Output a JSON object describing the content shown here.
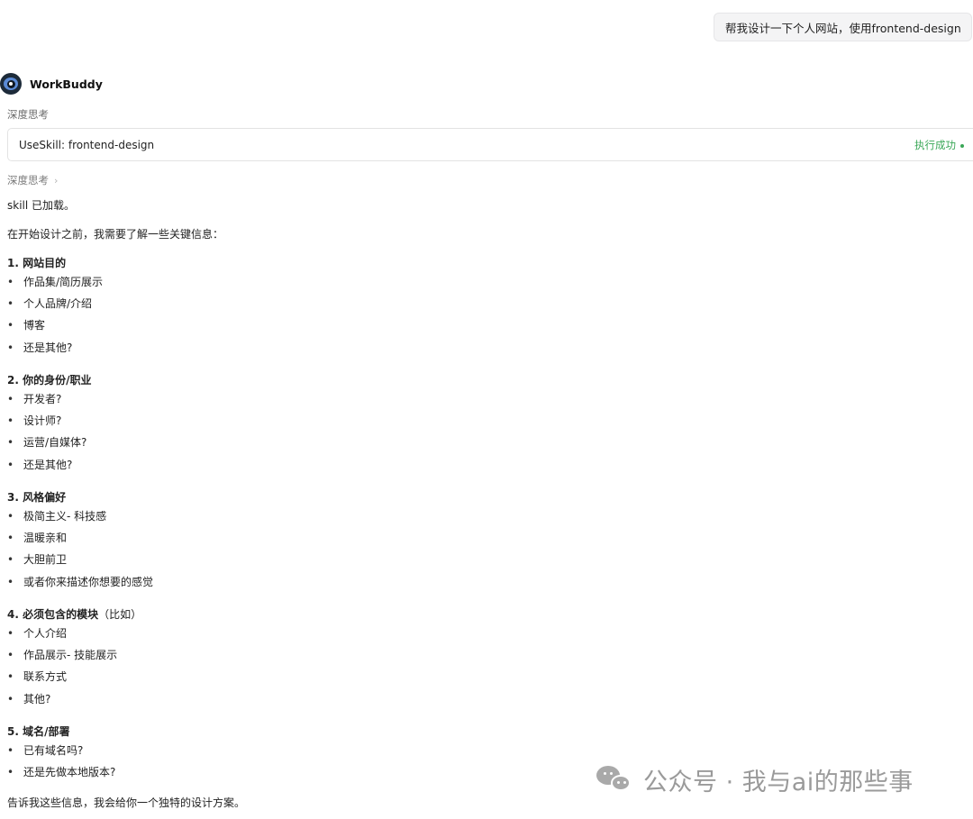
{
  "user_message": "帮我设计一下个人网站，使用frontend-design",
  "agent": {
    "name": "WorkBuddy"
  },
  "thinking_label": "深度思考",
  "skill_call": {
    "name": "UseSkill: frontend-design",
    "status": "执行成功",
    "status_color": "#3aa757"
  },
  "thinking_toggle": "深度思考",
  "response": {
    "loaded": "skill 已加载。",
    "intro": "在开始设计之前，我需要了解一些关键信息：",
    "sections": [
      {
        "title": "1. 网站目的",
        "items": [
          "作品集/简历展示",
          "个人品牌/介绍",
          "博客",
          "还是其他?"
        ]
      },
      {
        "title": "2. 你的身份/职业",
        "items": [
          "开发者?",
          "设计师?",
          "运营/自媒体?",
          "还是其他?"
        ]
      },
      {
        "title": "3. 风格偏好",
        "items": [
          "极简主义- 科技感",
          "温暖亲和",
          "大胆前卫",
          "或者你来描述你想要的感觉"
        ]
      },
      {
        "title": "4. 必须包含的模块",
        "note": "（比如）",
        "items": [
          "个人介绍",
          "作品展示- 技能展示",
          "联系方式",
          "其他?"
        ]
      },
      {
        "title": "5. 域名/部署",
        "items": [
          "已有域名吗?",
          "还是先做本地版本?"
        ]
      }
    ],
    "closing": "告诉我这些信息，我会给你一个独特的设计方案。"
  },
  "watermark": {
    "icon": "wechat-icon",
    "text": "公众号 · 我与ai的那些事"
  }
}
